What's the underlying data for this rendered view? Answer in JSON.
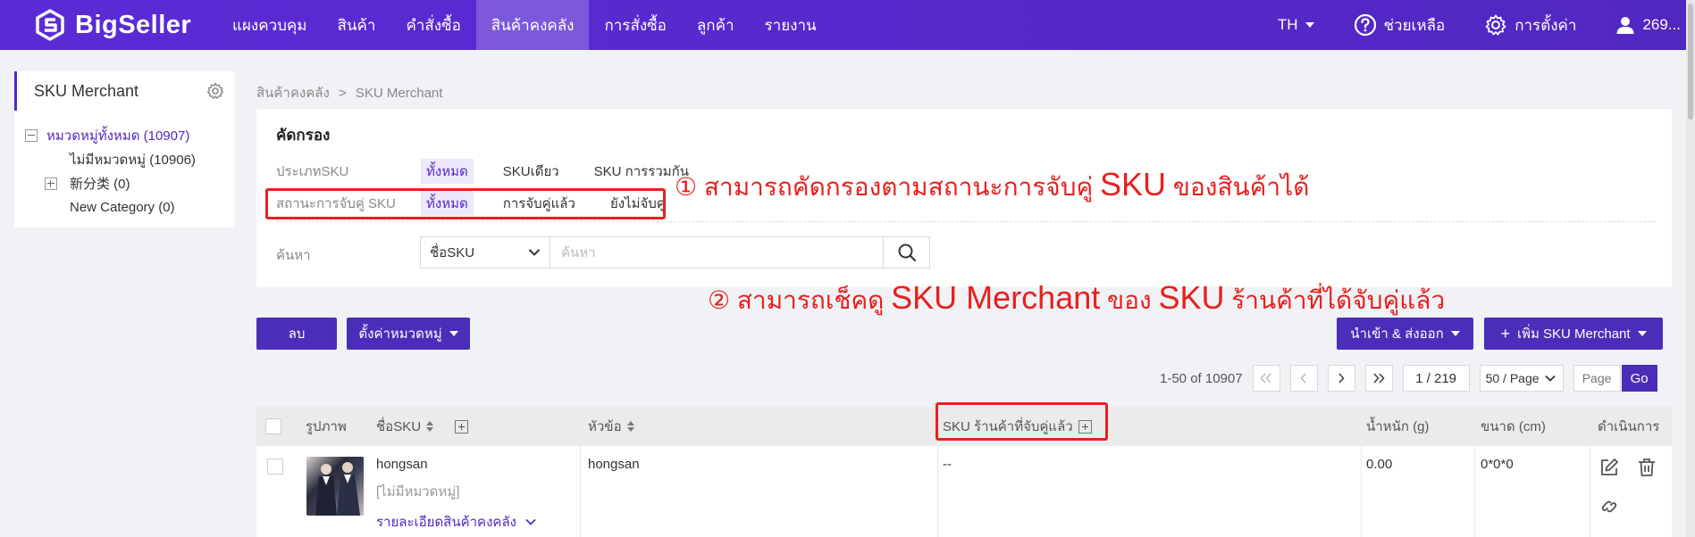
{
  "brand": {
    "name": "BigSeller"
  },
  "nav": {
    "items": [
      "แผงควบคุม",
      "สินค้า",
      "คำสั่งซื้อ",
      "สินค้าคงคลัง",
      "การสั่งซื้อ",
      "ลูกค้า",
      "รายงาน"
    ],
    "active_index": 3,
    "language": "TH",
    "help": "ช่วยเหลือ",
    "settings": "การตั้งค่า",
    "user": "269..."
  },
  "sidebar": {
    "title": "SKU Merchant",
    "tree": [
      {
        "label": "หมวดหมู่ทั้งหมด (10907)",
        "active": true
      },
      {
        "label": "ไม่มีหมวดหมู่ (10906)"
      },
      {
        "label": "新分类 (0)"
      },
      {
        "label": "New Category (0)"
      }
    ]
  },
  "breadcrumb": {
    "parent": "สินค้าคงคลัง",
    "separator": ">",
    "current": "SKU Merchant"
  },
  "filter": {
    "title": "คัดกรอง",
    "sku_type": {
      "label": "ประเภทSKU",
      "options": [
        "ทั้งหมด",
        "SKUเดียว",
        "SKU การรวมกัน"
      ],
      "selected": 0
    },
    "match_status": {
      "label": "สถานะการจับคู่ SKU",
      "options": [
        "ทั้งหมด",
        "การจับคู่แล้ว",
        "ยังไม่จับคู่"
      ],
      "selected": 0
    },
    "search": {
      "label": "ค้นหา",
      "field": "ชื่อSKU",
      "placeholder": "ค้นหา"
    }
  },
  "annotations": {
    "a1": {
      "num": "①",
      "pre": "สามารถคัดกรองตามสถานะการจับคู่",
      "sku": "SKU",
      "post": "ของสินค้าได้"
    },
    "a2": {
      "num": "②",
      "pre": "สามารถเช็คดู",
      "sku": "SKU Merchant",
      "mid": "ของ",
      "sku2": "SKU",
      "post": "ร้านค้าที่ได้จับคู่แล้ว"
    }
  },
  "actions": {
    "delete": "ลบ",
    "set_category": "ตั้งค่าหมวดหมู่",
    "import_export": "นำเข้า & ส่งออก",
    "add_sku": "เพิ่ม SKU Merchant"
  },
  "pagination": {
    "summary": "1-50 of 10907",
    "page": "1 / 219",
    "per_page": "50 / Page",
    "page_placeholder": "Page",
    "go": "Go"
  },
  "table": {
    "headers": {
      "image": "รูปภาพ",
      "sku_name": "ชื่อSKU",
      "title": "หัวข้อ",
      "store_sku": "SKU ร้านค้าที่จับคู่แล้ว",
      "weight": "น้ำหนัก (g)",
      "size": "ขนาด (cm)",
      "actions": "ดำเนินการ"
    },
    "rows": [
      {
        "sku": "hongsan",
        "category": "[ไม่มีหมวดหมู่]",
        "detail_link": "รายละเอียดสินค้าคงคลัง",
        "title": "hongsan",
        "store_sku": "--",
        "weight": "0.00",
        "size": "0*0*0"
      }
    ]
  },
  "colors": {
    "primary": "#5127c2",
    "annotation_red": "#e8201e"
  }
}
